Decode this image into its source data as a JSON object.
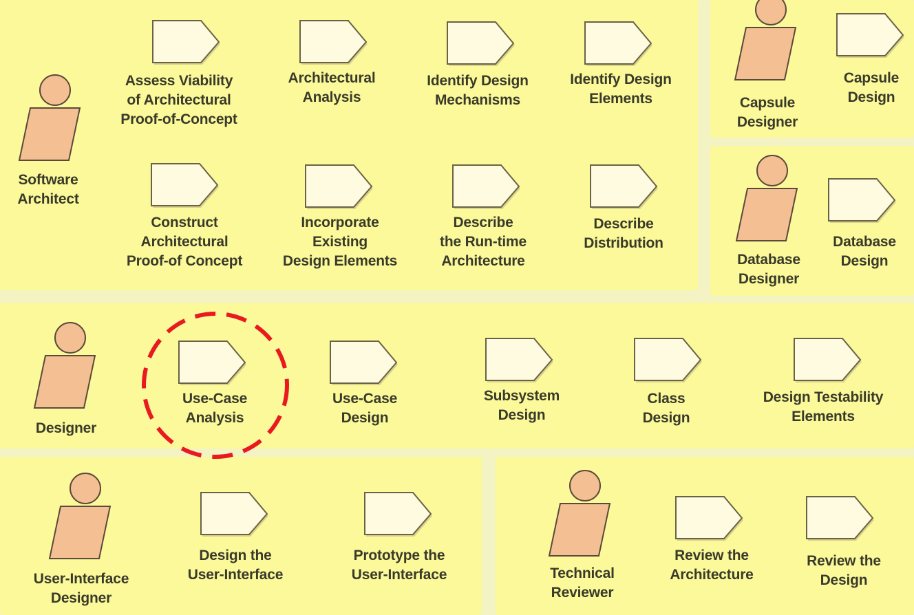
{
  "colors": {
    "background": "#f4f3c4",
    "panel": "#fbf99a",
    "actor_fill": "#f4bf92",
    "actor_stroke": "#5a4a3a",
    "activity_fill": "#fffbe0",
    "activity_stroke": "#6a6245",
    "highlight": "#e8191f",
    "text": "#3a3a2a"
  },
  "roles": {
    "software_architect": "Software\nArchitect",
    "capsule_designer": "Capsule\nDesigner",
    "database_designer": "Database\nDesigner",
    "designer": "Designer",
    "ui_designer": "User-Interface\nDesigner",
    "technical_reviewer": "Technical\nReviewer"
  },
  "activities": {
    "assess_viability": "Assess Viability\nof Architectural\nProof-of-Concept",
    "architectural_analysis": "Architectural\nAnalysis",
    "identify_mechanisms": "Identify Design\nMechanisms",
    "identify_elements": "Identify Design\nElements",
    "construct_poc": "Construct\nArchitectural\nProof-of Concept",
    "incorporate_elements": "Incorporate\nExisting\nDesign Elements",
    "describe_runtime": "Describe\nthe Run-time\nArchitecture",
    "describe_distribution": "Describe\nDistribution",
    "capsule_design": "Capsule\nDesign",
    "database_design": "Database\nDesign",
    "use_case_analysis": "Use-Case\nAnalysis",
    "use_case_design": "Use-Case\nDesign",
    "subsystem_design": "Subsystem\nDesign",
    "class_design": "Class\nDesign",
    "design_testability": "Design Testability\nElements",
    "design_ui": "Design the\nUser-Interface",
    "prototype_ui": "Prototype the\nUser-Interface",
    "review_architecture": "Review the\nArchitecture",
    "review_design": "Review the\nDesign"
  },
  "highlighted_activity": "use_case_analysis"
}
